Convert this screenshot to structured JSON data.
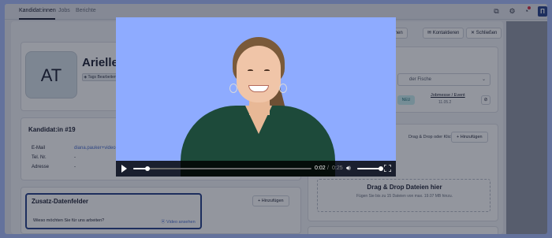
{
  "nav": {
    "tabs": [
      {
        "label": "Kandidat:innen",
        "active": true
      },
      {
        "label": "Jobs",
        "active": false
      },
      {
        "label": "Berichte",
        "active": false
      }
    ],
    "icons": [
      "puzzle-icon",
      "gear-icon",
      "bell-icon",
      "brand-logo"
    ]
  },
  "candidate": {
    "initials": "AT",
    "name": "Arielle",
    "tags_button": "Tags Bearbeiten",
    "header_buttons": {
      "ordnen": "ordnen",
      "kontaktieren": "Kontaktieren",
      "schliessen": "Schließen"
    }
  },
  "info": {
    "title": "Kandidat:in #19",
    "rows": [
      {
        "label": "E-Mail",
        "value": "diana.pauker+video@o"
      },
      {
        "label": "Tel. Nr.",
        "value": "-"
      },
      {
        "label": "Adresse",
        "value": "-"
      }
    ]
  },
  "status_panel": {
    "select_value": "der Fische",
    "pill": "NEU",
    "link": "Jobmesse / Event",
    "date": "11.05.2"
  },
  "documents": {
    "hint": "Drag & Drop oder Klick",
    "add_label": "Hinzufügen",
    "dropzone_title": "Drag & Drop Dateien hier",
    "dropzone_sub": "Fügen Sie bis zu 15 Dateien von max. 19.07 MB hinzu."
  },
  "extra_fields": {
    "title": "Zusatz-Datenfelder",
    "add_label": "Hinzufügen",
    "question": "Wieso möchten Sie für uns arbeiten?",
    "link": "Video ansehen"
  },
  "video": {
    "current_time": "0:02",
    "separator": "/",
    "duration": "0:25",
    "progress": 0.08,
    "volume": 1.0
  },
  "colors": {
    "accent": "#28428a",
    "video_bg": "#8eabff",
    "page_bg": "#a9bdfb"
  }
}
